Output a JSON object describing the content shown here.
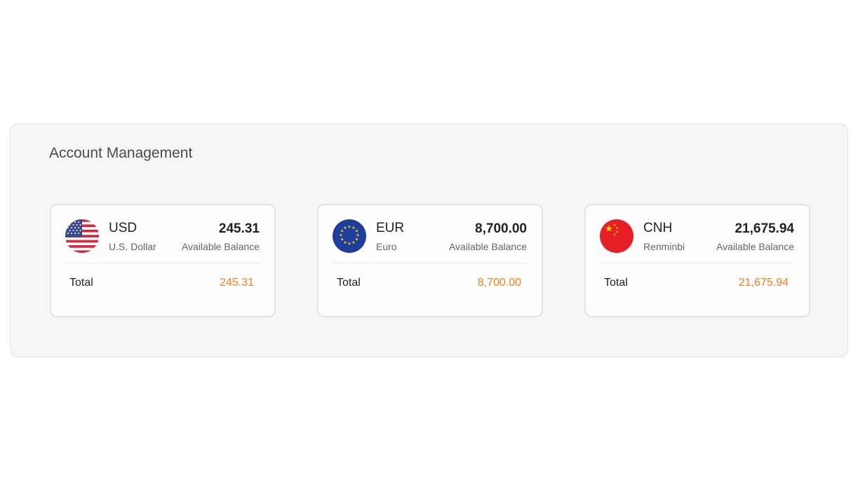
{
  "panel": {
    "title": "Account Management"
  },
  "accounts": [
    {
      "code": "USD",
      "name": "U.S. Dollar",
      "amount": "245.31",
      "balance_label": "Available Balance",
      "total_label": "Total",
      "total_value": "245.31",
      "flag_icon": "us-flag-icon"
    },
    {
      "code": "EUR",
      "name": "Euro",
      "amount": "8,700.00",
      "balance_label": "Available Balance",
      "total_label": "Total",
      "total_value": "8,700.00",
      "flag_icon": "eu-flag-icon"
    },
    {
      "code": "CNH",
      "name": "Renminbi",
      "amount": "21,675.94",
      "balance_label": "Available Balance",
      "total_label": "Total",
      "total_value": "21,675.94",
      "flag_icon": "cn-flag-icon"
    }
  ],
  "colors": {
    "accent": "#f07f1d",
    "panel_bg": "#f6f6f6",
    "card_border": "#e4e4e4"
  }
}
